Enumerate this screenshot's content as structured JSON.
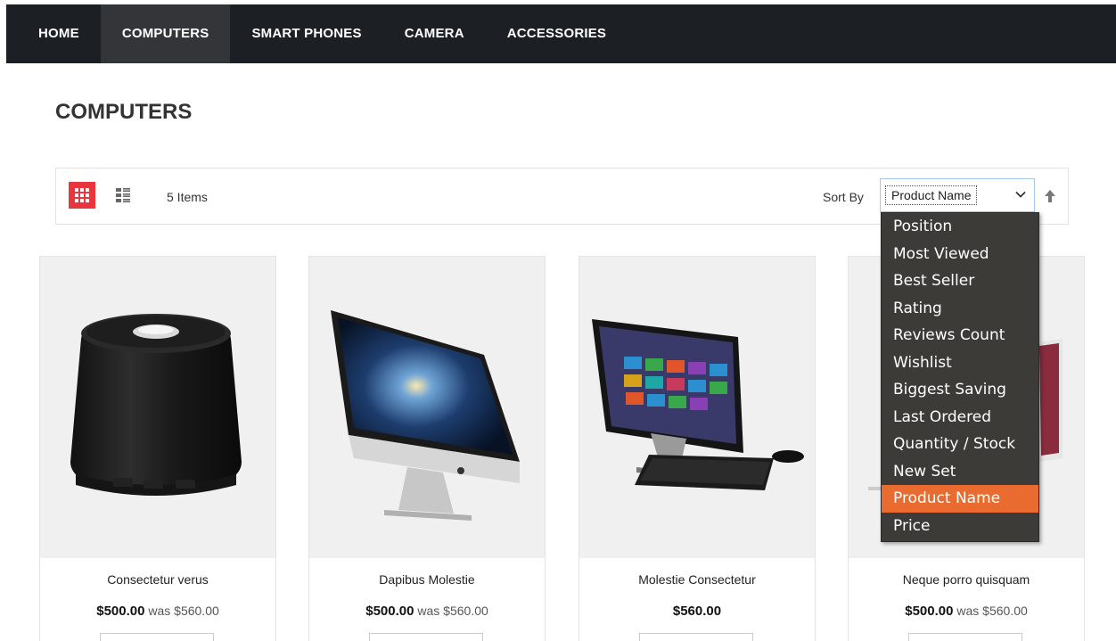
{
  "nav": {
    "items": [
      {
        "label": "HOME"
      },
      {
        "label": "COMPUTERS",
        "active": true
      },
      {
        "label": "SMART PHONES"
      },
      {
        "label": "CAMERA"
      },
      {
        "label": "ACCESSORIES"
      }
    ]
  },
  "page": {
    "title": "COMPUTERS"
  },
  "toolbar": {
    "items_count": "5 Items",
    "sort_label": "Sort By",
    "sort_value": "Product Name",
    "grid_icon": "grid-view-icon",
    "list_icon": "list-view-icon",
    "sort_direction_icon": "arrow-up-icon"
  },
  "sort_options": [
    "Position",
    "Most Viewed",
    "Best Seller",
    "Rating",
    "Reviews Count",
    "Wishlist",
    "Biggest Saving",
    "Last Ordered",
    "Quantity / Stock",
    "New Set",
    "Product Name",
    "Price"
  ],
  "products": [
    {
      "name": "Consectetur verus",
      "price": "$500.00",
      "old_price_label": "was",
      "old_price": "$560.00",
      "image": "speaker"
    },
    {
      "name": "Dapibus Molestie",
      "price": "$500.00",
      "old_price_label": "was",
      "old_price": "$560.00",
      "image": "imac"
    },
    {
      "name": "Molestie Consectetur",
      "price": "$560.00",
      "image": "all-in-one-pc"
    },
    {
      "name": "Neque porro quisquam",
      "price": "$500.00",
      "old_price_label": "was",
      "old_price": "$560.00",
      "image": "monitor"
    }
  ],
  "colors": {
    "nav_bg": "#1c1f24",
    "nav_active": "#333538",
    "accent_red": "#e8353e",
    "dropdown_bg": "#3c3b37",
    "dropdown_selected": "#e96b2f"
  }
}
